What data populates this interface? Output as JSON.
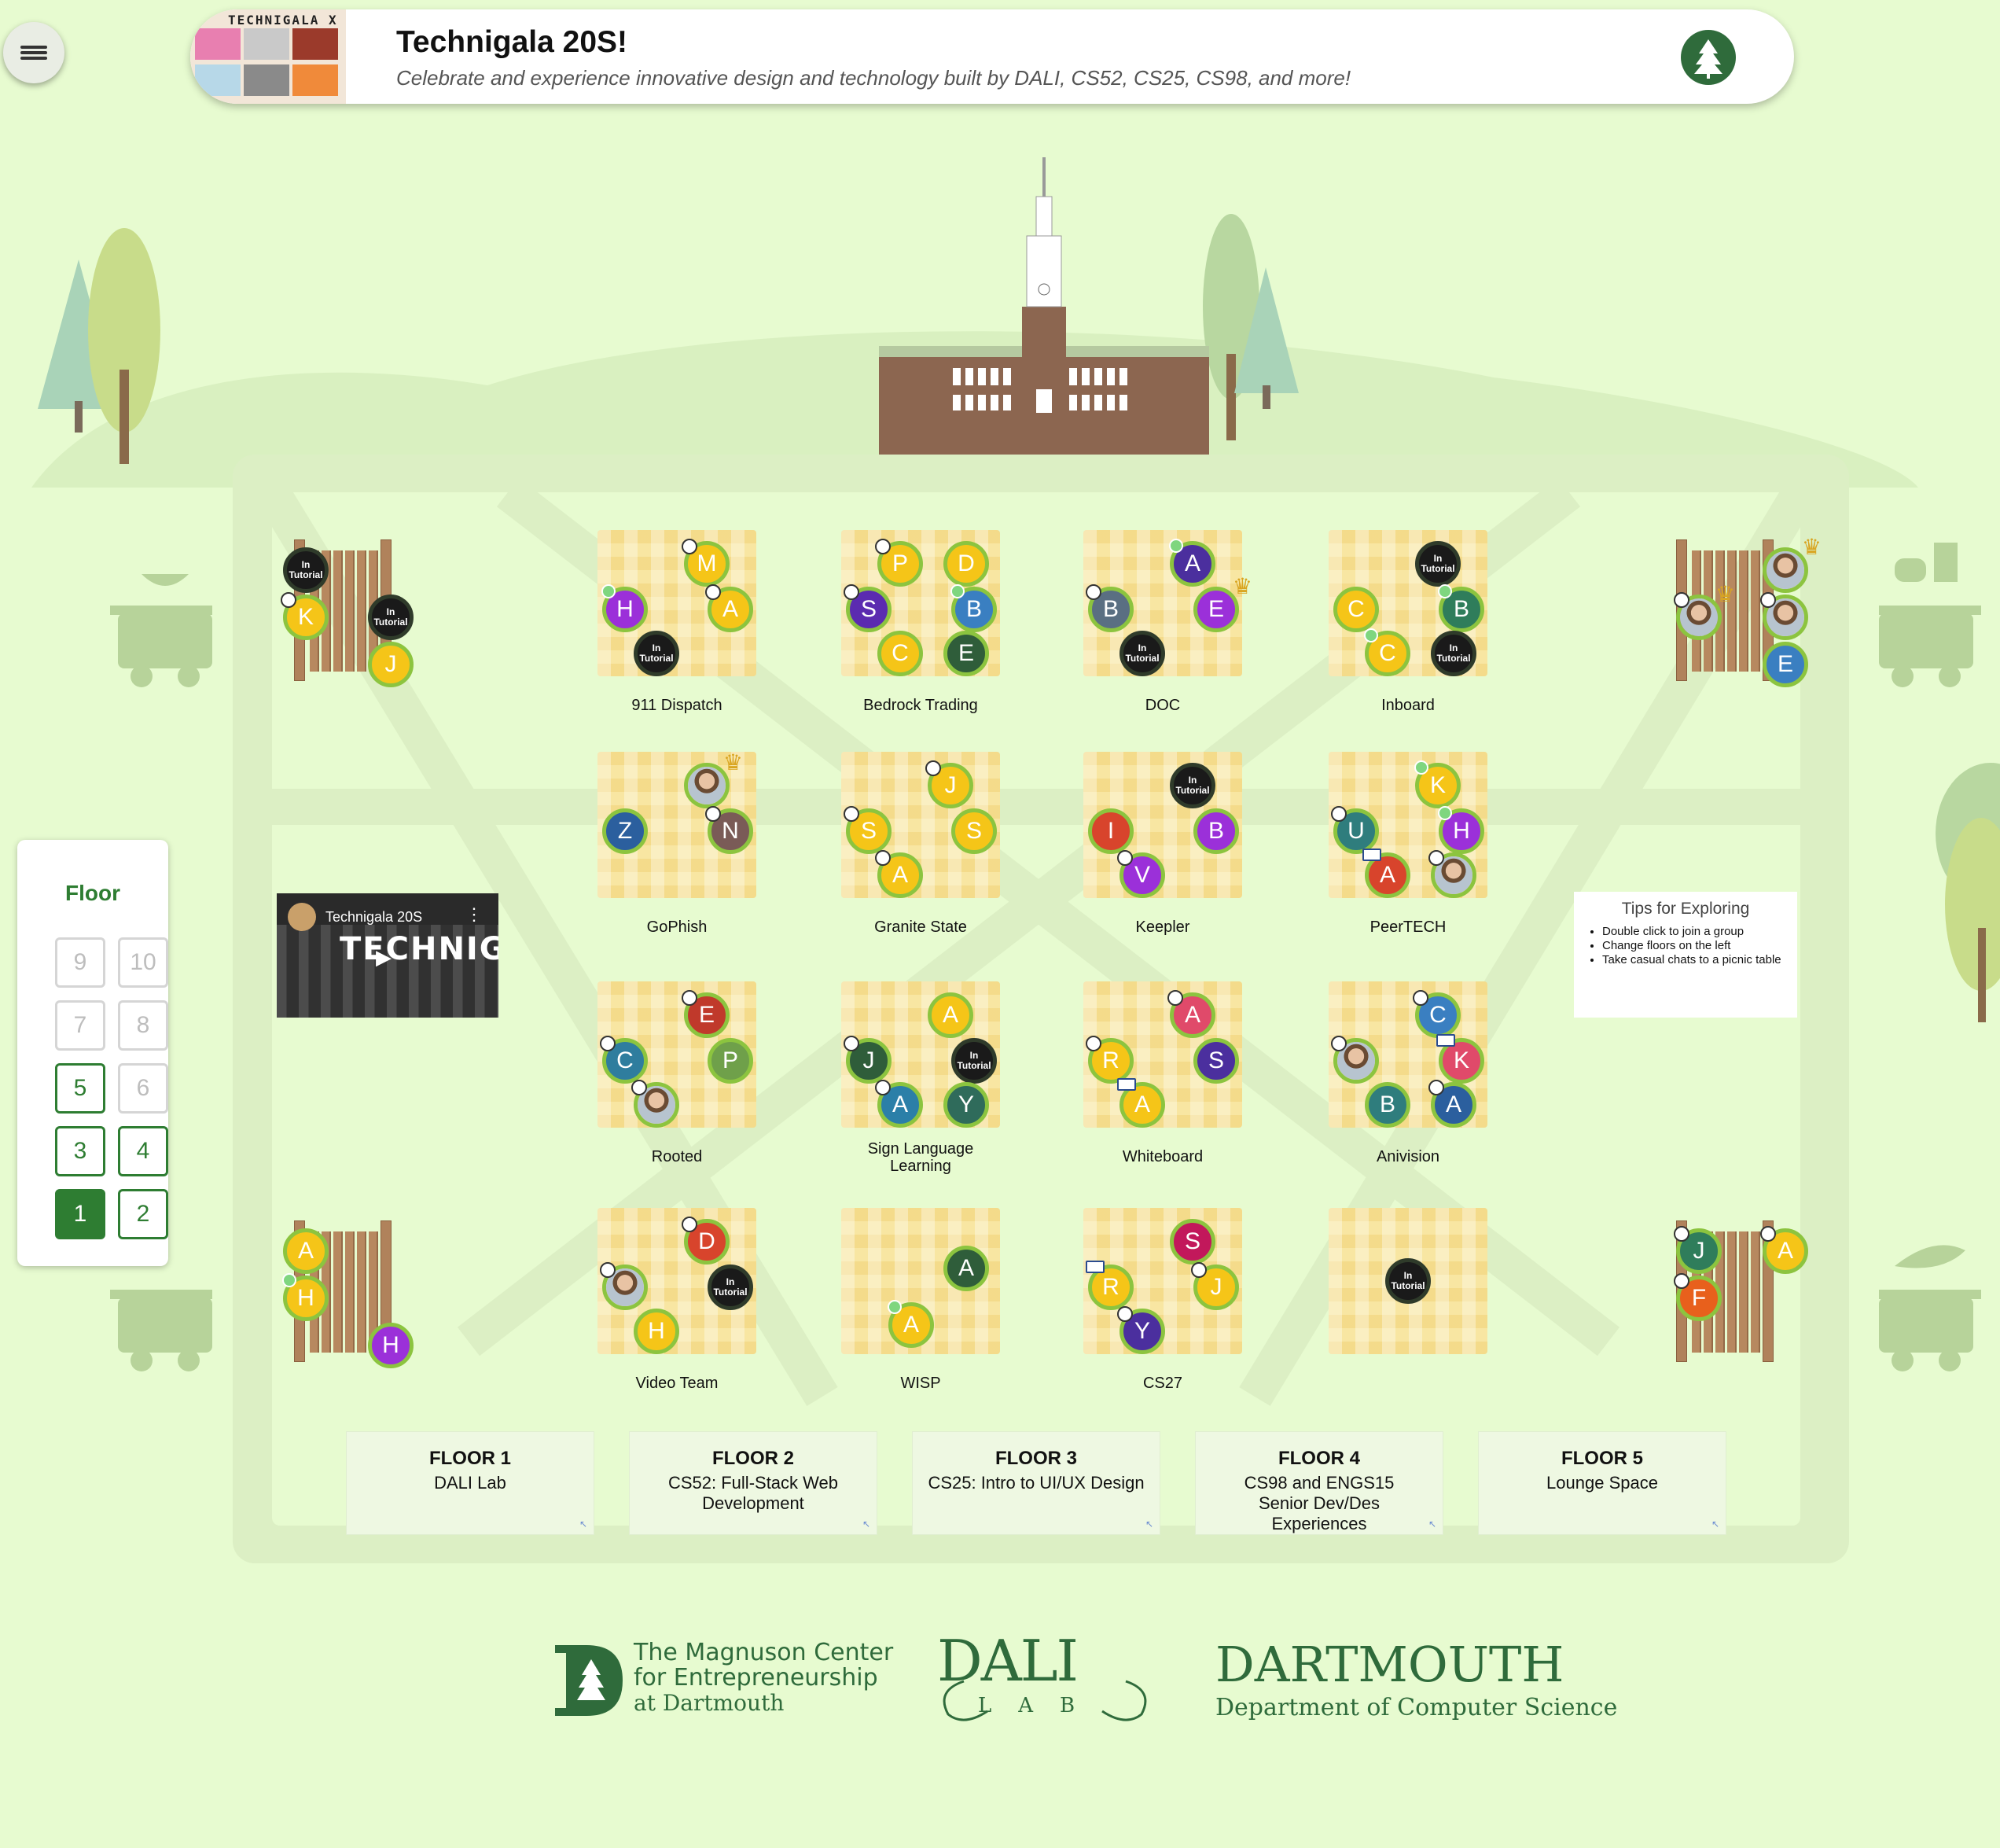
{
  "header": {
    "title": "Technigala 20S!",
    "subtitle": "Celebrate and experience innovative design and technology built by DALI, CS52, CS25, CS98, and more!",
    "thumb_text": "TECHNIGALA X"
  },
  "colors": {
    "accent": "#2e7d32",
    "background": "#e7fbd0",
    "table": "#f8e6a2",
    "presence_ring": "#8cc43f"
  },
  "tutorial_label": [
    "In",
    "Tutorial"
  ],
  "tables": [
    {
      "label": "911 Dispatch",
      "members": [
        {
          "i": "M",
          "c": "#f5c518",
          "cam": 1
        },
        {
          "i": "H",
          "c": "#9b30d9",
          "mic": 1
        },
        {
          "i": "A",
          "c": "#f5c518",
          "cam": 1
        },
        {
          "i": "T"
        }
      ]
    },
    {
      "label": "Bedrock Trading",
      "members": [
        {
          "i": "P",
          "c": "#f5c518",
          "cam": 1
        },
        {
          "i": "D",
          "c": "#f5c518"
        },
        {
          "i": "S",
          "c": "#5b2bb0",
          "cam": 1
        },
        {
          "i": "B",
          "c": "#3a7fc1",
          "mic": 1
        },
        {
          "i": "C",
          "c": "#f5c518"
        },
        {
          "i": "E",
          "c": "#2f5d3a"
        }
      ]
    },
    {
      "label": "DOC",
      "members": [
        {
          "i": "A",
          "c": "#4b2f9e",
          "mic": 1
        },
        {
          "i": "B",
          "c": "#5a6f82",
          "cam": 1
        },
        {
          "i": "E",
          "c": "#9b30d9",
          "crown": 1
        },
        {
          "i": "T"
        }
      ]
    },
    {
      "label": "Inboard",
      "members": [
        {
          "i": "T"
        },
        {
          "i": "C",
          "c": "#f5c518"
        },
        {
          "i": "B",
          "c": "#2f7d5b",
          "mic": 1
        },
        {
          "i": "C",
          "c": "#f5c518",
          "mic": 1
        },
        {
          "i": "T"
        }
      ]
    },
    {
      "label": "GoPhish",
      "members": [
        {
          "i": "",
          "photo": 1,
          "crown": 1
        },
        {
          "i": "Z",
          "c": "#2b5f9e"
        },
        {
          "i": "N",
          "c": "#7a5b57",
          "cam": 1
        }
      ]
    },
    {
      "label": "Granite State",
      "members": [
        {
          "i": "J",
          "c": "#f5c518",
          "cam": 1
        },
        {
          "i": "S",
          "c": "#f5c518",
          "cam": 1
        },
        {
          "i": "S",
          "c": "#f5c518"
        },
        {
          "i": "A",
          "c": "#f5c518",
          "cam": 1
        }
      ]
    },
    {
      "label": "Keepler",
      "members": [
        {
          "i": "T"
        },
        {
          "i": "I",
          "c": "#d8442c"
        },
        {
          "i": "B",
          "c": "#9b30d9"
        },
        {
          "i": "V",
          "c": "#9b30d9",
          "cam": 1
        }
      ]
    },
    {
      "label": "PeerTECH",
      "members": [
        {
          "i": "K",
          "c": "#f5c518",
          "mic": 1
        },
        {
          "i": "U",
          "c": "#2f7d7d",
          "cam": 1
        },
        {
          "i": "H",
          "c": "#9b30d9",
          "mic": 1
        },
        {
          "i": "A",
          "c": "#d8442c",
          "scr": 1
        },
        {
          "i": "",
          "photo": 1,
          "cam": 1
        }
      ]
    },
    {
      "label": "Rooted",
      "members": [
        {
          "i": "E",
          "c": "#c0392b",
          "cam": 1
        },
        {
          "i": "C",
          "c": "#2f7d9e",
          "cam": 1
        },
        {
          "i": "P",
          "c": "#6fa04a"
        },
        {
          "i": "",
          "photo": 1,
          "cam": 1
        }
      ]
    },
    {
      "label": "Sign Language Learning",
      "members": [
        {
          "i": "A",
          "c": "#f5c518"
        },
        {
          "i": "J",
          "c": "#2f5d3a",
          "cam": 1
        },
        {
          "i": "T"
        },
        {
          "i": "A",
          "c": "#2b7fa8",
          "cam": 1
        },
        {
          "i": "Y",
          "c": "#2f6b5b"
        }
      ]
    },
    {
      "label": "Whiteboard",
      "members": [
        {
          "i": "A",
          "c": "#e04a6a",
          "cam": 1
        },
        {
          "i": "R",
          "c": "#f5c518",
          "cam": 1
        },
        {
          "i": "S",
          "c": "#4b2f9e"
        },
        {
          "i": "A",
          "c": "#f5c518",
          "scr": 1
        }
      ]
    },
    {
      "label": "Anivision",
      "members": [
        {
          "i": "C",
          "c": "#3a7fc1",
          "cam": 1
        },
        {
          "i": "",
          "photo": 1,
          "cam": 1
        },
        {
          "i": "K",
          "c": "#e04a6a",
          "scr": 1
        },
        {
          "i": "B",
          "c": "#2f7d7d"
        },
        {
          "i": "A",
          "c": "#2b5f9e",
          "cam": 1
        }
      ]
    },
    {
      "label": "Video Team",
      "members": [
        {
          "i": "D",
          "c": "#d8442c",
          "cam": 1
        },
        {
          "i": "",
          "photo": 1,
          "cam": 1
        },
        {
          "i": "T"
        },
        {
          "i": "H",
          "c": "#f5c518"
        }
      ]
    },
    {
      "label": "WISP",
      "members": [
        {
          "i": "A",
          "c": "#2f5d3a"
        },
        {
          "i": "A",
          "c": "#f5c518",
          "mic": 1
        }
      ]
    },
    {
      "label": "CS27",
      "members": [
        {
          "i": "S",
          "c": "#c2185b"
        },
        {
          "i": "R",
          "c": "#f5c518",
          "scr": 1
        },
        {
          "i": "J",
          "c": "#f5c518",
          "cam": 1
        },
        {
          "i": "Y",
          "c": "#4b2f9e",
          "cam": 1
        }
      ]
    },
    {
      "label": "",
      "members": [
        {
          "i": "T"
        }
      ]
    }
  ],
  "benches": [
    {
      "members": [
        {
          "i": "T"
        },
        {
          "i": "K",
          "c": "#f5c518",
          "cam": 1
        },
        {
          "i": "T"
        },
        {
          "i": "J",
          "c": "#f5c518"
        }
      ]
    },
    {
      "members": [
        {
          "i": "",
          "photo": 1,
          "crown": 1
        },
        {
          "i": "",
          "photo": 1,
          "cam": 1,
          "crown": 1
        },
        {
          "i": "",
          "photo": 1,
          "cam": 1
        },
        {
          "i": "E",
          "c": "#3a7fc1"
        }
      ]
    },
    {
      "members": [
        {
          "i": "A",
          "c": "#f5c518"
        },
        {
          "i": "H",
          "c": "#f5c518",
          "mic": 1
        },
        {
          "i": "H",
          "c": "#9b30d9"
        }
      ]
    },
    {
      "members": [
        {
          "i": "J",
          "c": "#2f7d5b",
          "cam": 1
        },
        {
          "i": "A",
          "c": "#f5c518",
          "cam": 1
        },
        {
          "i": "F",
          "c": "#e8601c",
          "cam": 1
        }
      ]
    }
  ],
  "floor_panel": {
    "heading": "Floor",
    "buttons": [
      {
        "n": "9",
        "state": "disabled"
      },
      {
        "n": "10",
        "state": "disabled"
      },
      {
        "n": "7",
        "state": "disabled"
      },
      {
        "n": "8",
        "state": "disabled"
      },
      {
        "n": "5",
        "state": "enabled"
      },
      {
        "n": "6",
        "state": "disabled"
      },
      {
        "n": "3",
        "state": "enabled"
      },
      {
        "n": "4",
        "state": "enabled"
      },
      {
        "n": "1",
        "state": "active"
      },
      {
        "n": "2",
        "state": "enabled"
      }
    ]
  },
  "video": {
    "title": "Technigala 20S",
    "overlay_text": "TECHNIGALA"
  },
  "tips": {
    "title": "Tips for Exploring",
    "items": [
      "Double click to join a group",
      "Change floors on the left",
      "Take casual chats to a picnic table"
    ]
  },
  "floors": [
    {
      "name": "FLOOR 1",
      "desc": "DALI Lab"
    },
    {
      "name": "FLOOR 2",
      "desc": "CS52: Full-Stack Web Development"
    },
    {
      "name": "FLOOR 3",
      "desc": "CS25: Intro to UI/UX Design"
    },
    {
      "name": "FLOOR 4",
      "desc": "CS98 and ENGS15 Senior Dev/Des Experiences"
    },
    {
      "name": "FLOOR 5",
      "desc": "Lounge Space"
    }
  ],
  "footer": {
    "magnuson": [
      "The Magnuson Center",
      "for Entrepreneurship",
      "at Dartmouth"
    ],
    "dali": "DALI",
    "dali_sub": "LAB",
    "dartmouth": "DARTMOUTH",
    "dartmouth_sub": "Department of Computer Science"
  }
}
